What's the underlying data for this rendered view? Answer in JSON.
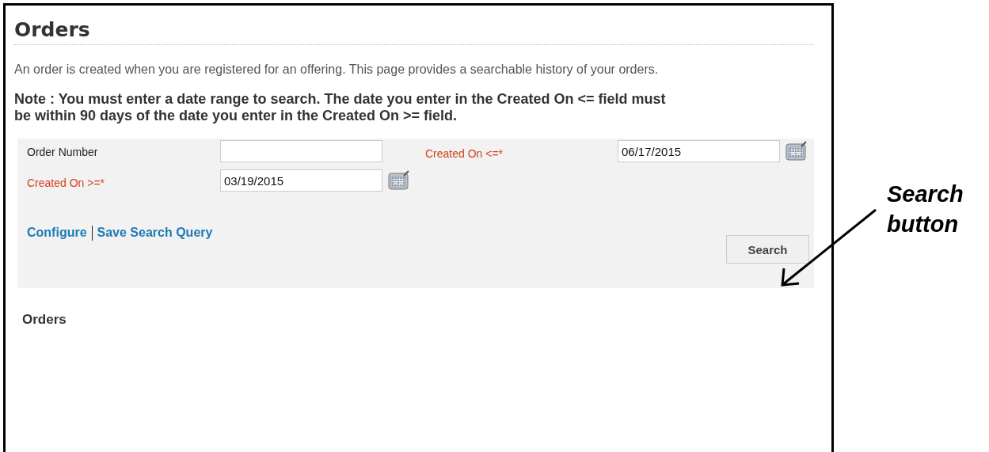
{
  "page": {
    "title": "Orders",
    "intro": "An order is created when you are registered for an offering. This page provides a searchable history of your orders.",
    "note": "Note : You must enter a date range to search. The date you enter in the Created On <= field must be within 90 days of the date you enter in the Created On >= field."
  },
  "search_form": {
    "fields": [
      {
        "label": "Order Number",
        "kind": "text",
        "required": false
      },
      {
        "label": "Created On <=*",
        "kind": "date",
        "required": true,
        "value": "06/17/2015"
      },
      {
        "label": "Created On >=*",
        "kind": "date",
        "required": true,
        "value": "03/19/2015"
      }
    ],
    "links": [
      "Configure",
      "Save Search Query"
    ],
    "search_button": "Search"
  },
  "results": {
    "heading": "Orders"
  },
  "annotation": {
    "text": "Search button"
  }
}
